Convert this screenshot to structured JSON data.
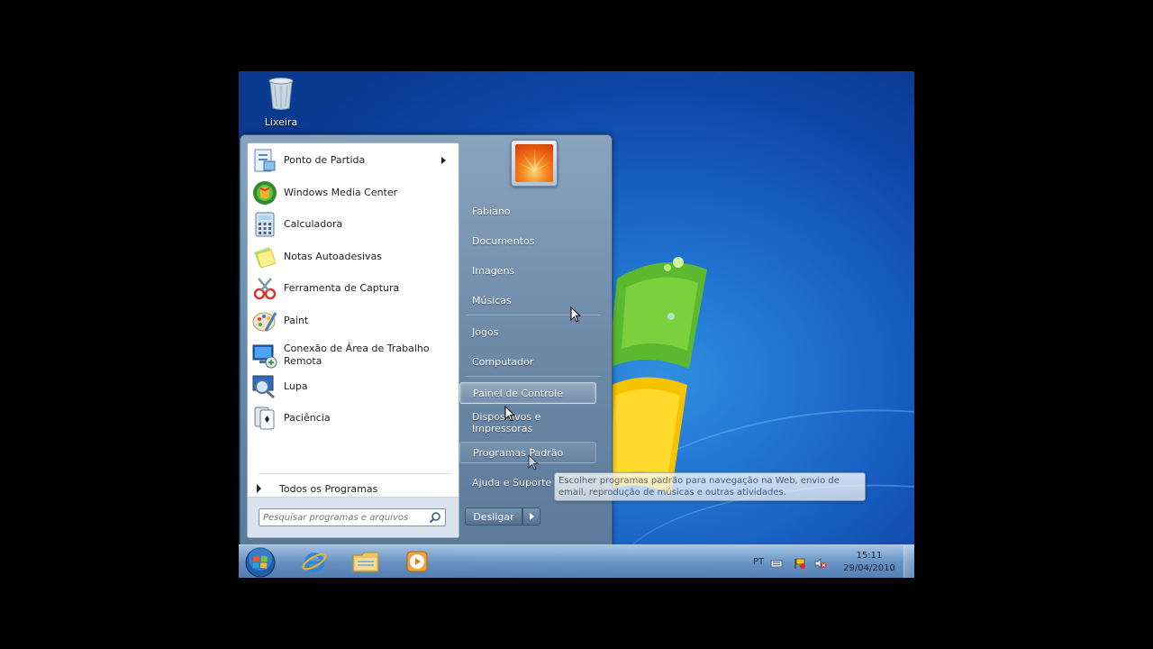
{
  "desktop": {
    "icons": [
      {
        "label": "Lixeira",
        "icon": "recycle-bin-icon"
      }
    ]
  },
  "start_menu": {
    "programs": [
      {
        "label": "Ponto de Partida",
        "icon": "getting-started-icon",
        "has_submenu": true
      },
      {
        "label": "Windows Media Center",
        "icon": "media-center-icon"
      },
      {
        "label": "Calculadora",
        "icon": "calculator-icon"
      },
      {
        "label": "Notas Autoadesivas",
        "icon": "sticky-notes-icon"
      },
      {
        "label": "Ferramenta de Captura",
        "icon": "snipping-tool-icon"
      },
      {
        "label": "Paint",
        "icon": "paint-icon"
      },
      {
        "label": "Conexão de Área de Trabalho Remota",
        "icon": "remote-desktop-icon"
      },
      {
        "label": "Lupa",
        "icon": "magnifier-icon"
      },
      {
        "label": "Paciência",
        "icon": "solitaire-icon"
      }
    ],
    "all_programs": "Todos os Programas",
    "search_placeholder": "Pesquisar programas e arquivos",
    "places": [
      {
        "label": "Fabiano"
      },
      {
        "label": "Documentos"
      },
      {
        "label": "Imagens"
      },
      {
        "label": "Músicas"
      },
      {
        "label": "Jogos"
      },
      {
        "label": "Computador"
      },
      {
        "label": "Painel de Controle",
        "highlighted": true
      },
      {
        "label": "Dispositivos e Impressoras"
      },
      {
        "label": "Programas Padrão",
        "hover": true
      },
      {
        "label": "Ajuda e Suporte"
      }
    ],
    "shutdown_label": "Desligar",
    "tooltip": "Escolher programas padrão para navegação na Web, envio de email, reprodução de músicas e outras atividades."
  },
  "taskbar": {
    "pinned": [
      "internet-explorer-icon",
      "windows-explorer-icon",
      "media-player-icon"
    ],
    "language": "PT",
    "time": "15:11",
    "date": "29/04/2010"
  }
}
